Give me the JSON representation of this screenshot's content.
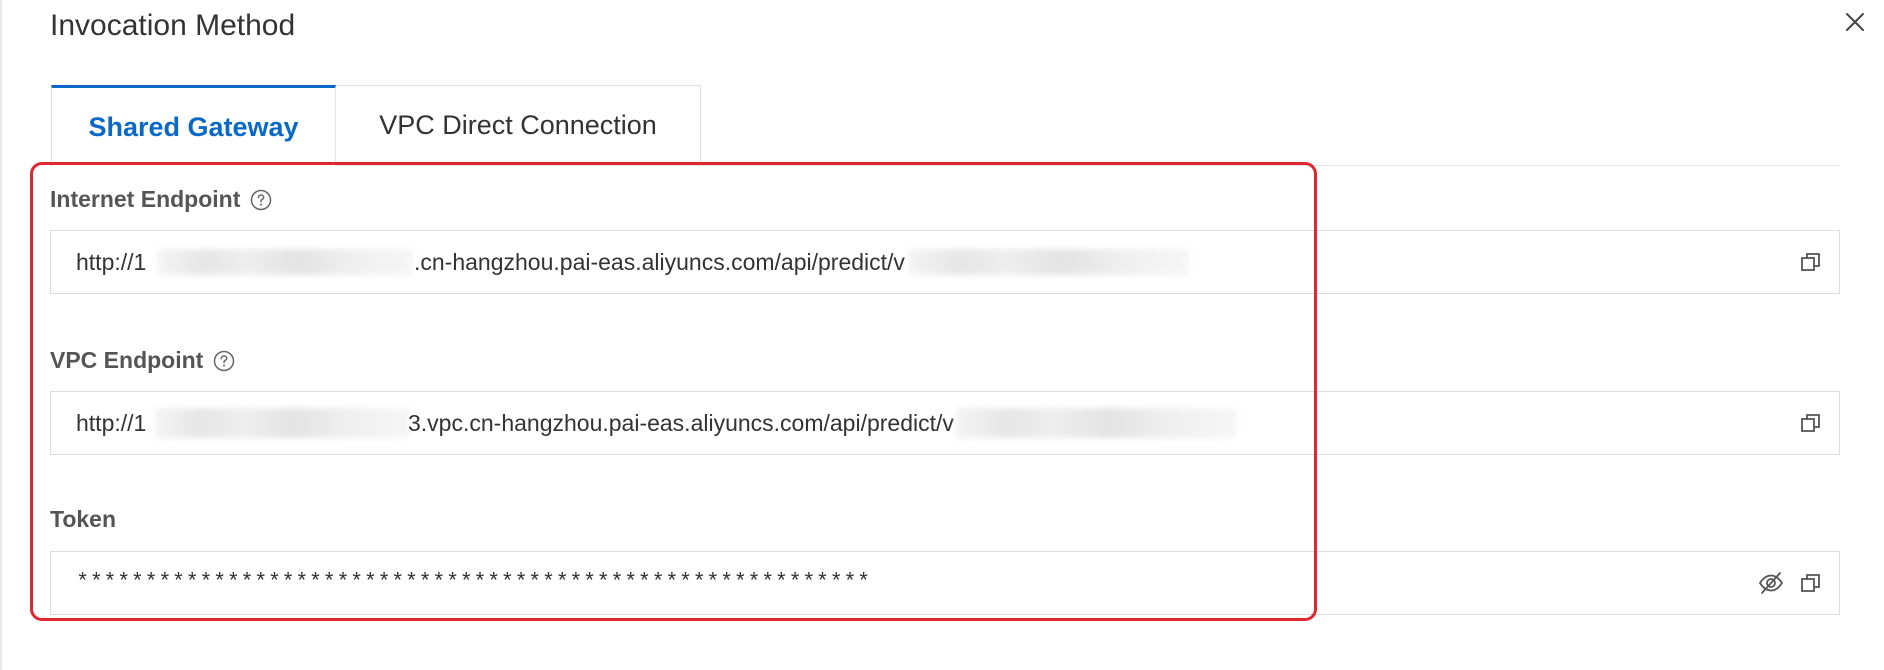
{
  "dialog": {
    "title": "Invocation Method",
    "close_icon": "close-icon"
  },
  "tabs": [
    {
      "label": "Shared Gateway",
      "active": true
    },
    {
      "label": "VPC Direct Connection",
      "active": false
    }
  ],
  "fields": {
    "internet": {
      "label": "Internet Endpoint",
      "help_icon": "question-circle-icon",
      "prefix": "http://1",
      "middle": ".cn-hangzhou.pai-eas.aliyuncs.com/api/predict/v",
      "copy_icon": "copy-icon"
    },
    "vpc": {
      "label": "VPC Endpoint",
      "help_icon": "question-circle-icon",
      "prefix": "http://1",
      "middle": "3.vpc.cn-hangzhou.pai-eas.aliyuncs.com/api/predict/v",
      "copy_icon": "copy-icon"
    },
    "token": {
      "label": "Token",
      "value": "**********************************************************",
      "eye_icon": "eye-slash-icon",
      "copy_icon": "copy-icon"
    }
  },
  "colors": {
    "accent": "#0a68c9",
    "highlight": "#e0262f",
    "text": "#333333",
    "label": "#555555",
    "border": "#dcdcdc"
  }
}
